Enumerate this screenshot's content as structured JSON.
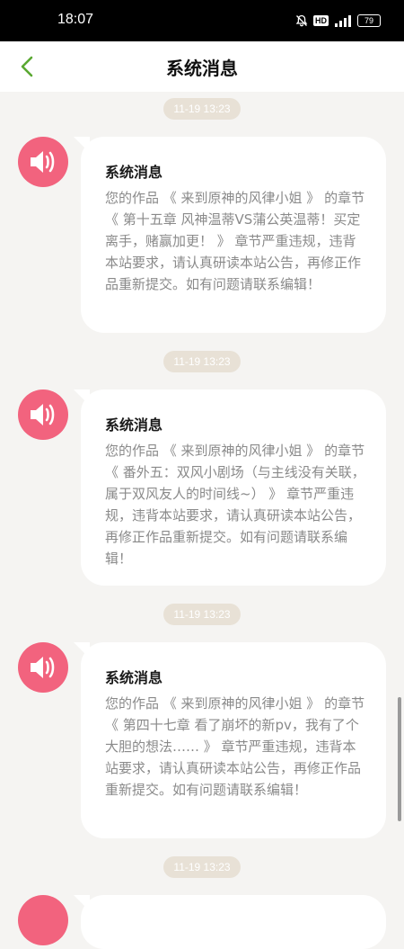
{
  "status_bar": {
    "time": "18:07",
    "battery": "79",
    "hd_label": "HD",
    "icons": [
      "mute-bell-icon",
      "hd-icon",
      "signal-icon",
      "battery-icon"
    ]
  },
  "header": {
    "title": "系统消息",
    "back_icon": "chevron-left-icon",
    "back_color": "#5aa832"
  },
  "colors": {
    "avatar": "#f2637e",
    "badge": "#e8e1d6",
    "background": "#f5f4f2"
  },
  "messages": [
    {
      "timestamp": "11-19 13:23",
      "title": "系统消息",
      "body": "您的作品 《 来到原神的风律小姐 》 的章节 《 第十五章 风神温蒂VS蒲公英温蒂！买定离手，赌赢加更！ 》 章节严重违规，违背本站要求，请认真研读本站公告，再修正作品重新提交。如有问题请联系编辑！"
    },
    {
      "timestamp": "11-19 13:23",
      "title": "系统消息",
      "body": "您的作品 《 来到原神的风律小姐 》 的章节 《 番外五：双风小剧场（与主线没有关联，属于双风友人的时间线~） 》 章节严重违规，违背本站要求，请认真研读本站公告，再修正作品重新提交。如有问题请联系编辑！"
    },
    {
      "timestamp": "11-19 13:23",
      "title": "系统消息",
      "body": "您的作品 《 来到原神的风律小姐 》 的章节 《 第四十七章 看了崩坏的新pv，我有了个大胆的想法…… 》 章节严重违规，违背本站要求，请认真研读本站公告，再修正作品重新提交。如有问题请联系编辑！"
    },
    {
      "timestamp": "11-19 13:23"
    }
  ]
}
